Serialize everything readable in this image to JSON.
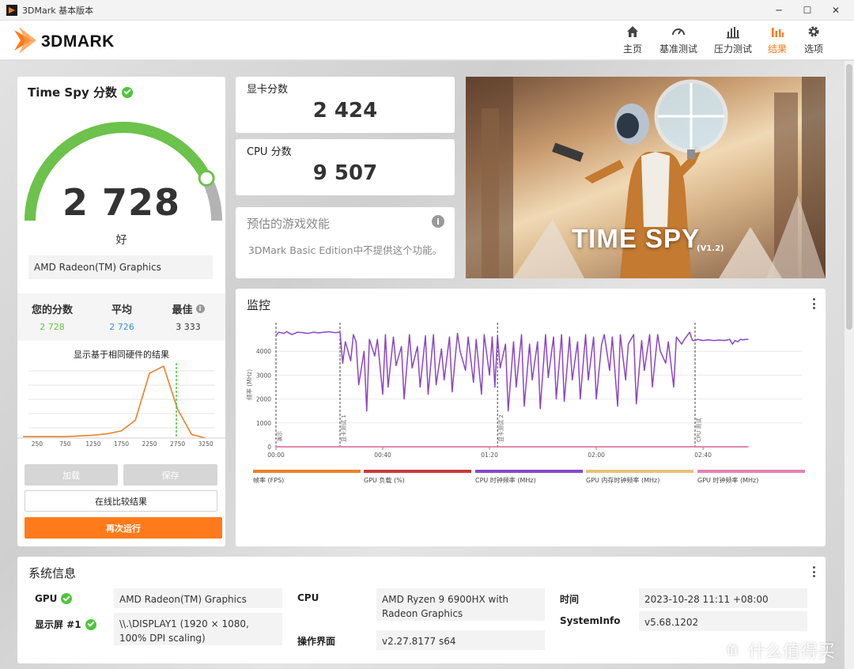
{
  "window": {
    "title": "3DMark 基本版本"
  },
  "header": {
    "logo_text": "3DMARK",
    "nav": [
      {
        "label": "主页",
        "icon": "home-icon",
        "active": false
      },
      {
        "label": "基准测试",
        "icon": "gauge-icon",
        "active": false
      },
      {
        "label": "压力测试",
        "icon": "stress-bars-icon",
        "active": false
      },
      {
        "label": "结果",
        "icon": "results-bars-icon",
        "active": true
      },
      {
        "label": "选项",
        "icon": "gear-icon",
        "active": false
      }
    ]
  },
  "colors": {
    "accent": "#ff7a1a",
    "good_green": "#6cc24a",
    "series_cpu_clock": "#8b46c8",
    "avg_blue": "#3a8ee6"
  },
  "score_card": {
    "title": "Time Spy 分数",
    "score": "2 728",
    "score_fraction": 0.85,
    "rating": "好",
    "gpu_name": "AMD Radeon(TM) Graphics",
    "stats": [
      {
        "label": "您的分数",
        "value": "2 728",
        "color": "#6cc24a"
      },
      {
        "label": "平均",
        "value": "2 726",
        "color": "#3a8ee6"
      },
      {
        "label": "最佳",
        "value": "3 333",
        "color": "#333333"
      }
    ],
    "distribution_title": "显示基于相同硬件的结果",
    "buttons": {
      "load": "加载",
      "save": "保存",
      "compare": "在线比较结果",
      "rerun": "再次运行"
    }
  },
  "gpu_score": {
    "label": "显卡分数",
    "value": "2 424"
  },
  "cpu_score": {
    "label": "CPU 分数",
    "value": "9 507"
  },
  "estimate": {
    "label": "预估的游戏效能",
    "message": "3DMark Basic Edition中不提供这个功能。"
  },
  "hero": {
    "title": "TIME SPY",
    "version": "(V1.2)"
  },
  "monitor": {
    "title": "监控",
    "legend": [
      {
        "label": "帧率 (FPS)",
        "color": "#e8822a"
      },
      {
        "label": "GPU 负载 (%)",
        "color": "#c83a3a"
      },
      {
        "label": "CPU 时钟频率 (MHz)",
        "color": "#8b46c8"
      },
      {
        "label": "GPU 内存时钟频率 (MHz)",
        "color": "#e6c27a"
      },
      {
        "label": "GPU 时钟频率 (MHz)",
        "color": "#e681b4"
      }
    ]
  },
  "chart_data": [
    {
      "type": "line",
      "title": "",
      "xlabel": "",
      "ylabel": "频率 (MHz)",
      "ylim": [
        0,
        5200
      ],
      "xlim": [
        0,
        197
      ],
      "x_tick_labels": [
        "00:00",
        "00:40",
        "01:20",
        "02:00",
        "02:40"
      ],
      "x_ticks": [
        0,
        40,
        80,
        120,
        160
      ],
      "y_ticks": [
        0,
        1000,
        2000,
        3000,
        4000
      ],
      "markers": [
        {
          "x": 0,
          "label": "演示"
        },
        {
          "x": 24,
          "label": "显卡测试 1"
        },
        {
          "x": 83,
          "label": "显卡测试 2"
        },
        {
          "x": 157,
          "label": "CPU 测试"
        }
      ],
      "series": [
        {
          "name": "CPU 时钟频率 (MHz)",
          "x": [
            0,
            1,
            3,
            4,
            6,
            8,
            10,
            12,
            14,
            16,
            18,
            20,
            22,
            24,
            25,
            26,
            28,
            29,
            30,
            31,
            33,
            34,
            35,
            37,
            38,
            40,
            41,
            42,
            44,
            45,
            47,
            48,
            50,
            51,
            53,
            54,
            56,
            57,
            59,
            60,
            62,
            63,
            65,
            66,
            68,
            69,
            71,
            72,
            74,
            75,
            77,
            78,
            80,
            81,
            82,
            83,
            84,
            86,
            87,
            89,
            90,
            92,
            93,
            95,
            96,
            98,
            99,
            101,
            102,
            104,
            105,
            107,
            108,
            110,
            111,
            113,
            114,
            116,
            117,
            119,
            120,
            122,
            123,
            125,
            126,
            128,
            129,
            131,
            132,
            134,
            135,
            137,
            138,
            140,
            141,
            143,
            144,
            146,
            147,
            149,
            150,
            152,
            153,
            155,
            156,
            157,
            158,
            160,
            162,
            164,
            166,
            168,
            170,
            171,
            172,
            173,
            174,
            175,
            176,
            177
          ],
          "values": [
            4650,
            4800,
            4750,
            4820,
            4700,
            4800,
            4780,
            4750,
            4800,
            4770,
            4800,
            4820,
            4780,
            4800,
            3500,
            4400,
            3600,
            4700,
            4400,
            2600,
            4000,
            1500,
            4500,
            3800,
            4500,
            2200,
            4700,
            2500,
            4600,
            3400,
            4200,
            2000,
            4700,
            3300,
            4200,
            2500,
            4650,
            2200,
            4700,
            2600,
            4100,
            2800,
            4600,
            2300,
            4750,
            4000,
            3200,
            4600,
            2700,
            4500,
            2200,
            4700,
            3000,
            4600,
            2500,
            4650,
            3300,
            4300,
            1500,
            4400,
            2500,
            4700,
            1700,
            4300,
            2800,
            4400,
            1600,
            4700,
            2900,
            4600,
            2000,
            4700,
            1900,
            4600,
            2800,
            4400,
            2000,
            4700,
            2800,
            4600,
            2000,
            4300,
            4700,
            3200,
            4600,
            1700,
            4700,
            2800,
            4300,
            4700,
            1800,
            4450,
            3200,
            4700,
            2500,
            4700,
            4000,
            3500,
            4400,
            2500,
            4600,
            4300,
            4500,
            4800,
            4450,
            4450,
            4500,
            4450,
            4480,
            4450,
            4470,
            4450,
            4500,
            4300,
            4450,
            4400,
            4500,
            4480,
            4500,
            4500
          ]
        },
        {
          "name": "GPU 负载 (%)",
          "x": [
            0,
            177
          ],
          "values": [
            0,
            0
          ]
        },
        {
          "name": "GPU 时钟频率 (MHz)",
          "x": [
            0,
            177
          ],
          "values": [
            0,
            0
          ]
        }
      ]
    },
    {
      "type": "area",
      "title": "显示基于相同硬件的结果",
      "x_tick_labels": [
        "250",
        "750",
        "1250",
        "1750",
        "2250",
        "2750",
        "3250"
      ],
      "x": [
        0,
        250,
        500,
        750,
        1000,
        1250,
        1500,
        1750,
        2000,
        2250,
        2500,
        2750,
        3000,
        3250
      ],
      "values": [
        0.02,
        0.02,
        0.02,
        0.02,
        0.03,
        0.04,
        0.06,
        0.1,
        0.25,
        0.9,
        1.0,
        0.4,
        0.05,
        0.0
      ],
      "marker_x": 2728
    }
  ],
  "sysinfo": {
    "title": "系统信息",
    "gpu_label": "GPU",
    "gpu_value": "AMD Radeon(TM) Graphics",
    "display_label": "显示屏 #1",
    "display_value": "\\\\.\\DISPLAY1 (1920 × 1080, 100% DPI scaling)",
    "cpu_label": "CPU",
    "cpu_value": "AMD Ryzen 9 6900HX with Radeon Graphics",
    "os_label": "操作界面",
    "os_value": "v2.27.8177 s64",
    "time_label": "时间",
    "time_value": "2023-10-28 11:11 +08:00",
    "si_label": "SystemInfo",
    "si_value": "v5.68.1202"
  },
  "watermark": {
    "text": "什么值得买",
    "icon_glyph": "值"
  }
}
